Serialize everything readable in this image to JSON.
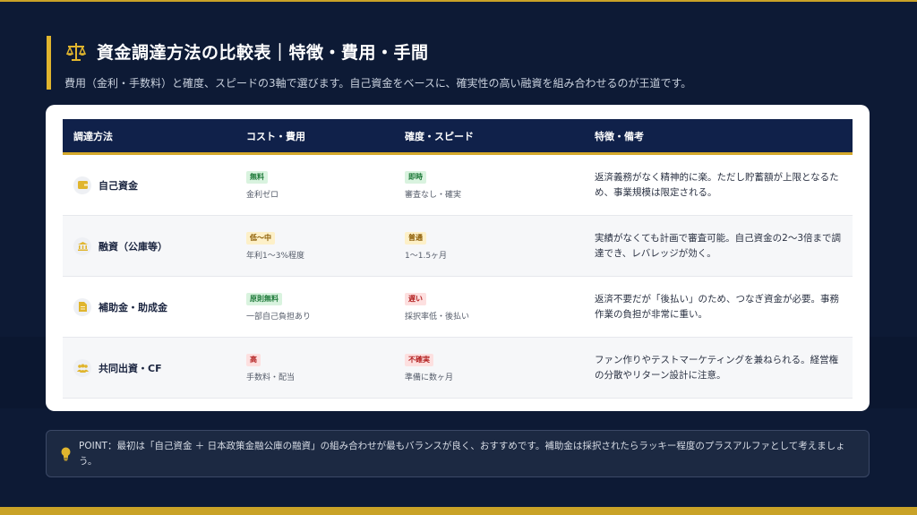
{
  "header": {
    "title": "資金調達方法の比較表｜特徴・費用・手間",
    "subtitle": "費用（金利・手数料）と確度、スピードの3軸で選びます。自己資金をベースに、確実性の高い融資を組み合わせるのが王道です。"
  },
  "table": {
    "headers": [
      "調達方法",
      "コスト・費用",
      "確度・スピード",
      "特徴・備考"
    ],
    "rows": [
      {
        "method": "自己資金",
        "icon": "wallet-icon",
        "cost_badge": "無料",
        "cost_note": "金利ゼロ",
        "speed_badge": "即時",
        "speed_note": "審査なし・確実",
        "desc": "返済義務がなく精神的に楽。ただし貯蓄額が上限となるため、事業規模は限定される。"
      },
      {
        "method": "融資（公庫等）",
        "icon": "bank-icon",
        "cost_badge": "低〜中",
        "cost_note": "年利1〜3%程度",
        "speed_badge": "普通",
        "speed_note": "1〜1.5ヶ月",
        "desc": "実績がなくても計画で審査可能。自己資金の2〜3倍まで調達でき、レバレッジが効く。"
      },
      {
        "method": "補助金・助成金",
        "icon": "document-icon",
        "cost_badge": "原則無料",
        "cost_note": "一部自己負担あり",
        "speed_badge": "遅い",
        "speed_note": "採択率低・後払い",
        "desc": "返済不要だが「後払い」のため、つなぎ資金が必要。事務作業の負担が非常に重い。"
      },
      {
        "method": "共同出資・CF",
        "icon": "people-icon",
        "cost_badge": "高",
        "cost_note": "手数料・配当",
        "speed_badge": "不確実",
        "speed_note": "準備に数ヶ月",
        "desc": "ファン作りやテストマーケティングを兼ねられる。経営権の分散やリターン設計に注意。"
      }
    ]
  },
  "point": {
    "text": "POINT：最初は「自己資金 ＋ 日本政策金融公庫の融資」の組み合わせが最もバランスが良く、おすすめです。補助金は採択されたらラッキー程度のプラスアルファとして考えましょう。",
    "icon": "lightbulb-icon"
  },
  "colors": {
    "background": "#0d1a35",
    "accent": "#e0b52e",
    "table_header": "#10214a",
    "badge_green": "#1f7a3a",
    "badge_yellow": "#8a5a00",
    "badge_red": "#b42323"
  }
}
